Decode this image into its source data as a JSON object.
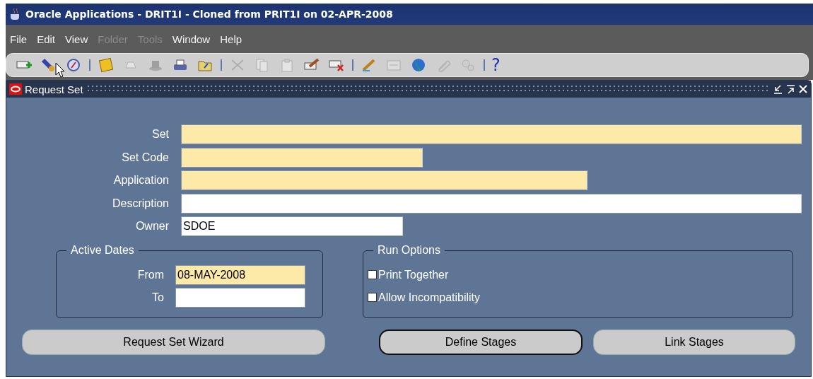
{
  "app_title": "Oracle Applications - DRIT1I - Cloned from PRIT1I on 02-APR-2008",
  "menu": [
    {
      "label": "File",
      "disabled": false
    },
    {
      "label": "Edit",
      "disabled": false
    },
    {
      "label": "View",
      "disabled": false
    },
    {
      "label": "Folder",
      "disabled": true
    },
    {
      "label": "Tools",
      "disabled": true
    },
    {
      "label": "Window",
      "disabled": false
    },
    {
      "label": "Help",
      "disabled": false
    }
  ],
  "toolbar": [
    {
      "kind": "add-row",
      "disabled": false
    },
    {
      "kind": "flashlight",
      "disabled": false
    },
    {
      "kind": "compass",
      "disabled": false
    },
    {
      "kind": "separator"
    },
    {
      "kind": "floppy-disk",
      "disabled": false
    },
    {
      "kind": "stamp",
      "disabled": true
    },
    {
      "kind": "hat",
      "disabled": true
    },
    {
      "kind": "printer",
      "disabled": false
    },
    {
      "kind": "folder",
      "disabled": false
    },
    {
      "kind": "separator"
    },
    {
      "kind": "scissors",
      "disabled": true
    },
    {
      "kind": "documents",
      "disabled": true
    },
    {
      "kind": "clipboard",
      "disabled": true
    },
    {
      "kind": "eraser",
      "disabled": false
    },
    {
      "kind": "delete-row",
      "disabled": false
    },
    {
      "kind": "separator"
    },
    {
      "kind": "pencil",
      "disabled": false
    },
    {
      "kind": "card-file",
      "disabled": true
    },
    {
      "kind": "globe",
      "disabled": false
    },
    {
      "kind": "paperclip",
      "disabled": true
    },
    {
      "kind": "gears",
      "disabled": true
    },
    {
      "kind": "separator"
    },
    {
      "kind": "help",
      "disabled": false,
      "text": "?"
    }
  ],
  "window": {
    "title": "Request Set",
    "fields": [
      {
        "label": "Set",
        "required": true
      },
      {
        "label": "Set Code",
        "required": true
      },
      {
        "label": "Application",
        "required": true
      },
      {
        "label": "Description",
        "required": false
      },
      {
        "label": "Owner",
        "value": "SDOE",
        "required": false
      }
    ],
    "active_dates": {
      "title": "Active Dates",
      "fields": [
        {
          "label": "From",
          "value": "08-MAY-2008",
          "required": true
        },
        {
          "label": "To",
          "required": false
        }
      ]
    },
    "run_options": {
      "title": "Run Options",
      "options": [
        {
          "label": "Print Together",
          "checked": false
        },
        {
          "label": "Allow Incompatibility",
          "checked": false
        }
      ]
    },
    "buttons": [
      {
        "label": "Request Set Wizard",
        "focused": false
      },
      {
        "label": "Define Stages",
        "focused": true
      },
      {
        "label": "Link Stages",
        "focused": false
      }
    ]
  }
}
